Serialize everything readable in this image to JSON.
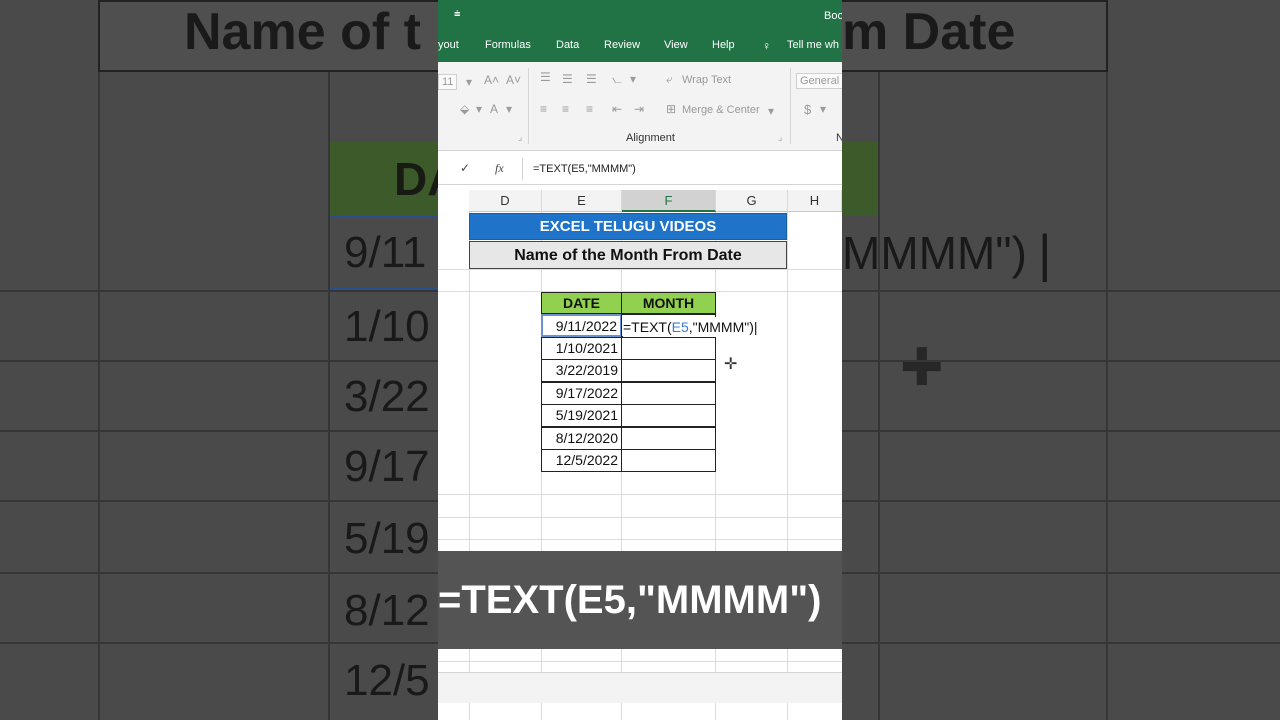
{
  "background": {
    "banner_text": "Name of the Month From Date",
    "banner_left": "Name of t",
    "banner_right": "m Date",
    "date_header": "DA",
    "formula_tail": "MMMM\")",
    "dates": [
      "9/11",
      "1/10",
      "3/22",
      "9/17",
      "5/19",
      "8/12",
      "12/5"
    ]
  },
  "ribbon": {
    "qat_glyph": "⩧",
    "book_name": "Boo",
    "menu": [
      "yout",
      "Formulas",
      "Data",
      "Review",
      "View",
      "Help"
    ],
    "tell_me": "Tell me wh",
    "font_size": "11",
    "wrap_text": "Wrap Text",
    "merge_center": "Merge & Center",
    "alignment_label": "Alignment",
    "number_format": "General",
    "currency": "$"
  },
  "formula_bar": {
    "check": "✓",
    "fx": "fx",
    "formula": "=TEXT(E5,\"MMMM\")"
  },
  "columns": [
    "D",
    "E",
    "F",
    "G",
    "H"
  ],
  "sheet": {
    "title": "EXCEL TELUGU VIDEOS",
    "subtitle": "Name of the Month From Date",
    "header_date": "DATE",
    "header_month": "MONTH",
    "dates": [
      "9/11/2022",
      "1/10/2021",
      "3/22/2019",
      "9/17/2022",
      "5/19/2021",
      "8/12/2020",
      "12/5/2022"
    ],
    "edit_prefix": "=TEXT(",
    "edit_ref": "E5",
    "edit_suffix": ",\"MMMM\")"
  },
  "overlay_text": "=TEXT(E5,\"MMMM\")",
  "colors": {
    "excel_green": "#217346",
    "title_blue": "#1f74c9",
    "header_green": "#92d050"
  }
}
